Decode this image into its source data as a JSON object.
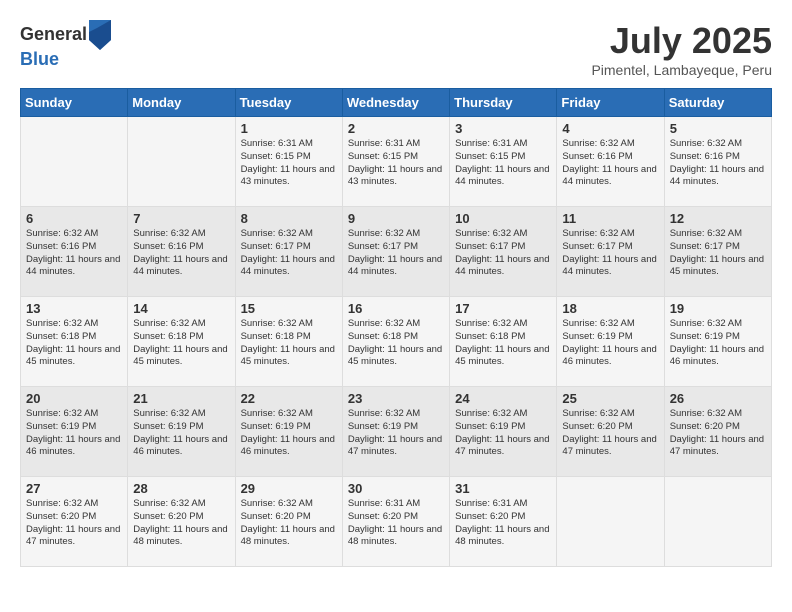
{
  "header": {
    "logo_general": "General",
    "logo_blue": "Blue",
    "month_title": "July 2025",
    "location": "Pimentel, Lambayeque, Peru"
  },
  "weekdays": [
    "Sunday",
    "Monday",
    "Tuesday",
    "Wednesday",
    "Thursday",
    "Friday",
    "Saturday"
  ],
  "weeks": [
    [
      {
        "day": "",
        "info": ""
      },
      {
        "day": "",
        "info": ""
      },
      {
        "day": "1",
        "info": "Sunrise: 6:31 AM\nSunset: 6:15 PM\nDaylight: 11 hours and 43 minutes."
      },
      {
        "day": "2",
        "info": "Sunrise: 6:31 AM\nSunset: 6:15 PM\nDaylight: 11 hours and 43 minutes."
      },
      {
        "day": "3",
        "info": "Sunrise: 6:31 AM\nSunset: 6:15 PM\nDaylight: 11 hours and 44 minutes."
      },
      {
        "day": "4",
        "info": "Sunrise: 6:32 AM\nSunset: 6:16 PM\nDaylight: 11 hours and 44 minutes."
      },
      {
        "day": "5",
        "info": "Sunrise: 6:32 AM\nSunset: 6:16 PM\nDaylight: 11 hours and 44 minutes."
      }
    ],
    [
      {
        "day": "6",
        "info": "Sunrise: 6:32 AM\nSunset: 6:16 PM\nDaylight: 11 hours and 44 minutes."
      },
      {
        "day": "7",
        "info": "Sunrise: 6:32 AM\nSunset: 6:16 PM\nDaylight: 11 hours and 44 minutes."
      },
      {
        "day": "8",
        "info": "Sunrise: 6:32 AM\nSunset: 6:17 PM\nDaylight: 11 hours and 44 minutes."
      },
      {
        "day": "9",
        "info": "Sunrise: 6:32 AM\nSunset: 6:17 PM\nDaylight: 11 hours and 44 minutes."
      },
      {
        "day": "10",
        "info": "Sunrise: 6:32 AM\nSunset: 6:17 PM\nDaylight: 11 hours and 44 minutes."
      },
      {
        "day": "11",
        "info": "Sunrise: 6:32 AM\nSunset: 6:17 PM\nDaylight: 11 hours and 44 minutes."
      },
      {
        "day": "12",
        "info": "Sunrise: 6:32 AM\nSunset: 6:17 PM\nDaylight: 11 hours and 45 minutes."
      }
    ],
    [
      {
        "day": "13",
        "info": "Sunrise: 6:32 AM\nSunset: 6:18 PM\nDaylight: 11 hours and 45 minutes."
      },
      {
        "day": "14",
        "info": "Sunrise: 6:32 AM\nSunset: 6:18 PM\nDaylight: 11 hours and 45 minutes."
      },
      {
        "day": "15",
        "info": "Sunrise: 6:32 AM\nSunset: 6:18 PM\nDaylight: 11 hours and 45 minutes."
      },
      {
        "day": "16",
        "info": "Sunrise: 6:32 AM\nSunset: 6:18 PM\nDaylight: 11 hours and 45 minutes."
      },
      {
        "day": "17",
        "info": "Sunrise: 6:32 AM\nSunset: 6:18 PM\nDaylight: 11 hours and 45 minutes."
      },
      {
        "day": "18",
        "info": "Sunrise: 6:32 AM\nSunset: 6:19 PM\nDaylight: 11 hours and 46 minutes."
      },
      {
        "day": "19",
        "info": "Sunrise: 6:32 AM\nSunset: 6:19 PM\nDaylight: 11 hours and 46 minutes."
      }
    ],
    [
      {
        "day": "20",
        "info": "Sunrise: 6:32 AM\nSunset: 6:19 PM\nDaylight: 11 hours and 46 minutes."
      },
      {
        "day": "21",
        "info": "Sunrise: 6:32 AM\nSunset: 6:19 PM\nDaylight: 11 hours and 46 minutes."
      },
      {
        "day": "22",
        "info": "Sunrise: 6:32 AM\nSunset: 6:19 PM\nDaylight: 11 hours and 46 minutes."
      },
      {
        "day": "23",
        "info": "Sunrise: 6:32 AM\nSunset: 6:19 PM\nDaylight: 11 hours and 47 minutes."
      },
      {
        "day": "24",
        "info": "Sunrise: 6:32 AM\nSunset: 6:19 PM\nDaylight: 11 hours and 47 minutes."
      },
      {
        "day": "25",
        "info": "Sunrise: 6:32 AM\nSunset: 6:20 PM\nDaylight: 11 hours and 47 minutes."
      },
      {
        "day": "26",
        "info": "Sunrise: 6:32 AM\nSunset: 6:20 PM\nDaylight: 11 hours and 47 minutes."
      }
    ],
    [
      {
        "day": "27",
        "info": "Sunrise: 6:32 AM\nSunset: 6:20 PM\nDaylight: 11 hours and 47 minutes."
      },
      {
        "day": "28",
        "info": "Sunrise: 6:32 AM\nSunset: 6:20 PM\nDaylight: 11 hours and 48 minutes."
      },
      {
        "day": "29",
        "info": "Sunrise: 6:32 AM\nSunset: 6:20 PM\nDaylight: 11 hours and 48 minutes."
      },
      {
        "day": "30",
        "info": "Sunrise: 6:31 AM\nSunset: 6:20 PM\nDaylight: 11 hours and 48 minutes."
      },
      {
        "day": "31",
        "info": "Sunrise: 6:31 AM\nSunset: 6:20 PM\nDaylight: 11 hours and 48 minutes."
      },
      {
        "day": "",
        "info": ""
      },
      {
        "day": "",
        "info": ""
      }
    ]
  ]
}
